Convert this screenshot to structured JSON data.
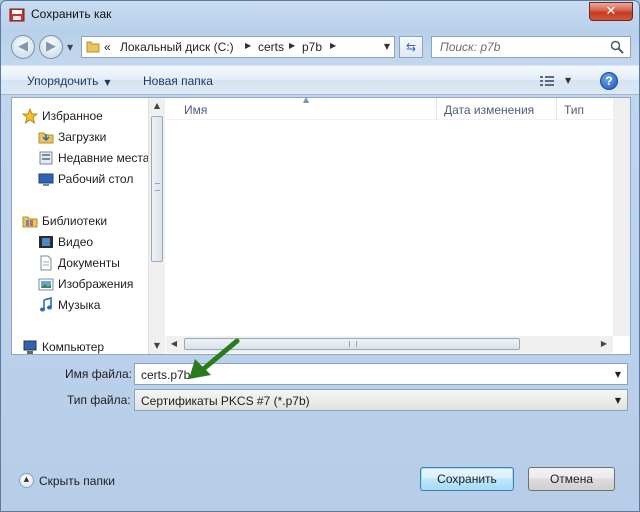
{
  "window": {
    "title": "Сохранить как",
    "close_label": "✕"
  },
  "navbar": {
    "back_glyph": "◀",
    "forward_glyph": "▶",
    "breadcrumb_overflow": "«",
    "breadcrumbs": [
      "Локальный диск (C:)",
      "certs",
      "p7b"
    ],
    "search_placeholder": "Поиск: p7b"
  },
  "toolbar": {
    "organize_label": "Упорядочить",
    "new_folder_label": "Новая папка",
    "help_label": "?"
  },
  "nav_pane": {
    "groups": [
      {
        "label": "Избранное",
        "icon": "star-icon"
      },
      {
        "label": "Загрузки",
        "icon": "downloads-folder-icon"
      },
      {
        "label": "Недавние места",
        "icon": "recent-places-icon"
      },
      {
        "label": "Рабочий стол",
        "icon": "desktop-icon"
      },
      {
        "label": "Библиотеки",
        "icon": "libraries-icon"
      },
      {
        "label": "Видео",
        "icon": "video-icon"
      },
      {
        "label": "Документы",
        "icon": "documents-icon"
      },
      {
        "label": "Изображения",
        "icon": "pictures-icon"
      },
      {
        "label": "Музыка",
        "icon": "music-icon"
      },
      {
        "label": "Компьютер",
        "icon": "computer-icon"
      }
    ]
  },
  "file_list": {
    "columns": [
      "Имя",
      "Дата изменения",
      "Тип"
    ]
  },
  "form": {
    "filename_label": "Имя файла:",
    "filename_value": "certs.p7b",
    "filetype_label": "Тип файла:",
    "filetype_value": "Сертификаты PKCS #7 (*.p7b)"
  },
  "footer": {
    "hide_folders_label": "Скрыть папки",
    "save_label": "Сохранить",
    "cancel_label": "Отмена"
  },
  "colors": {
    "arrow_annotation": "#2a7a1e",
    "close_button": "#c94a30",
    "frame": "#b9d0ea"
  }
}
